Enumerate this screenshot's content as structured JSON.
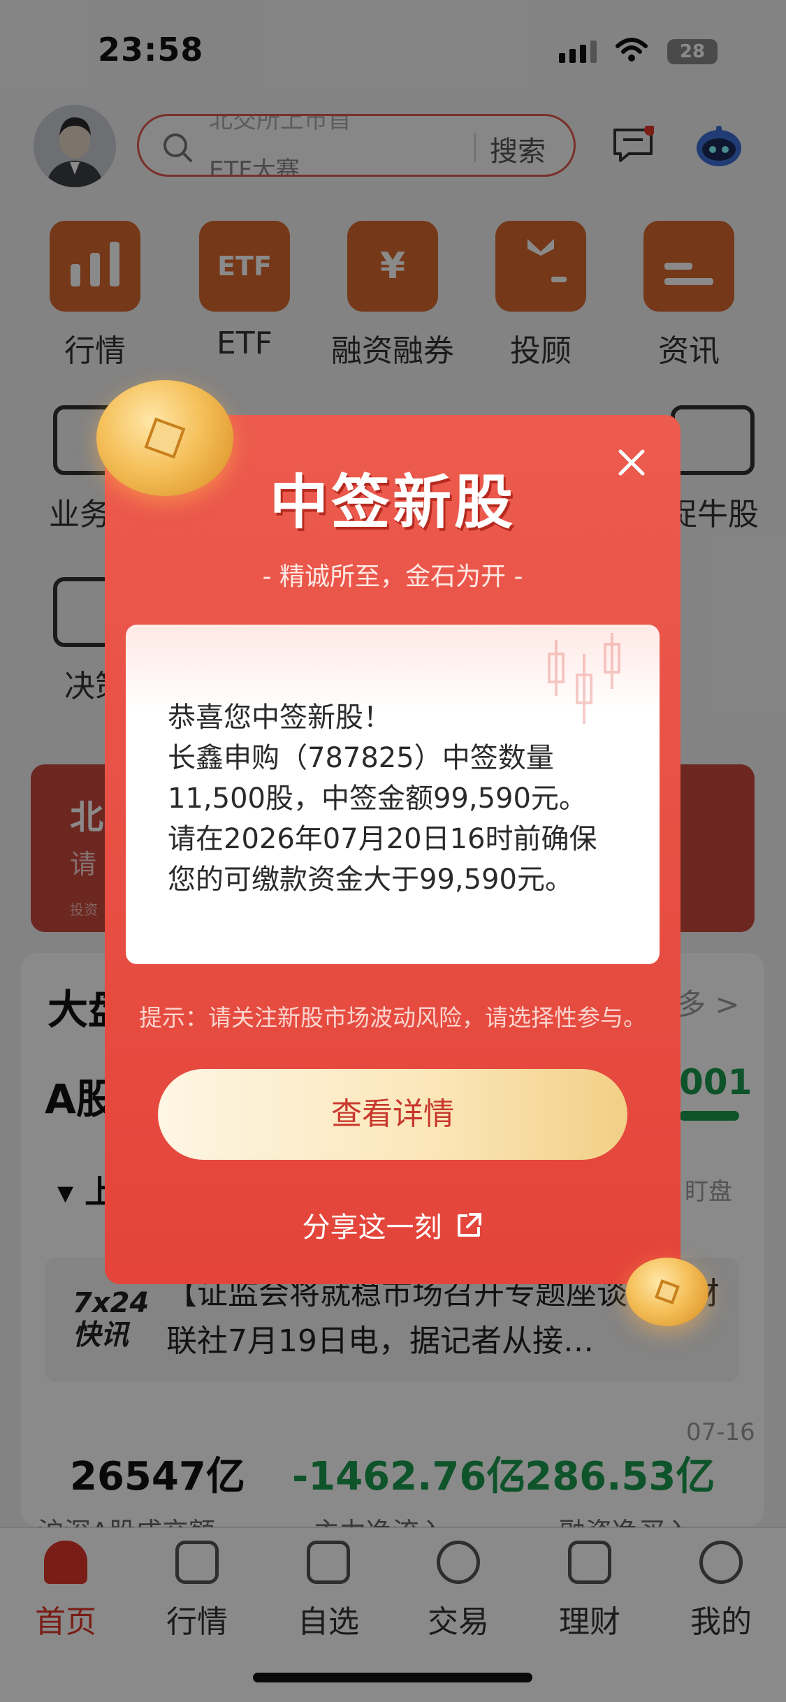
{
  "status_bar": {
    "time": "23:58",
    "battery": "28"
  },
  "header": {
    "search_prev": "北交所上市首",
    "search_current": "ETF大赛",
    "search_button": "搜索"
  },
  "quick_menu": {
    "row1": [
      "行情",
      "ETF",
      "融资融券",
      "投顾",
      "资讯"
    ],
    "row2_left": "业务办",
    "row2_right": "捉牛股",
    "row3_left": "决策"
  },
  "icons": {
    "etf_icon_text": "ETF",
    "yuan_icon_text": "¥"
  },
  "background": {
    "banner_title": "北",
    "banner_sub": "请",
    "banner_small": "投资",
    "section_title": "大盘",
    "more": "多 >",
    "a_share": "A股",
    "index_value": "001",
    "market_toggle": "▾ 上",
    "pan_label": "盯盘",
    "news_logo_1": "7x24",
    "news_logo_2": "快讯",
    "news_text": "【证监会将就稳市场召开专题座谈会】财联社7月19日电，据记者从接…",
    "date": "07-16",
    "stats": [
      {
        "value": "26547亿",
        "label": "沪深A股成交额"
      },
      {
        "value": "-1462.76亿",
        "label": "主力净流入"
      },
      {
        "value": "-286.53亿",
        "label": "融资净买入"
      }
    ]
  },
  "tabbar": {
    "tabs": [
      {
        "label": "首页",
        "active": true
      },
      {
        "label": "行情",
        "active": false
      },
      {
        "label": "自选",
        "active": false
      },
      {
        "label": "交易",
        "active": false
      },
      {
        "label": "理财",
        "active": false
      },
      {
        "label": "我的",
        "active": false
      }
    ]
  },
  "modal": {
    "title": "中签新股",
    "subtitle": "- 精诚所至，金石为开 -",
    "lines": [
      "恭喜您中签新股！",
      "长鑫申购（787825）中签数量",
      "11,500股，中签金额99,590元。",
      "请在2026年07月20日16时前确保",
      "您的可缴款资金大于99,590元。"
    ],
    "tip": "提示：请关注新股市场波动风险，请选择性参与。",
    "cta": "查看详情",
    "share": "分享这一刻"
  },
  "colors": {
    "brand_red": "#e0362a",
    "modal_red": "#e4443a",
    "cta_gold": "#f2cf86",
    "positive_green": "#1a9a4f"
  }
}
